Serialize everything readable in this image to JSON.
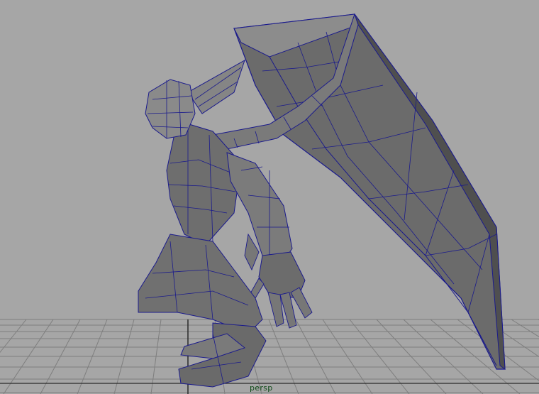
{
  "viewport": {
    "camera_label": "persp"
  },
  "colors": {
    "background": "#a6a6a6",
    "grid": "#7e7e7e",
    "grid_center": "#2a2a2a",
    "wireframe": "#1a1a8c",
    "mesh_light": "#8a8a8a",
    "mesh_mid": "#6a6a6a",
    "mesh_dark": "#4a4a4a",
    "camera_label": "#0d4a16"
  },
  "model": {
    "description_icon": "winged-creature-mesh-icon"
  }
}
